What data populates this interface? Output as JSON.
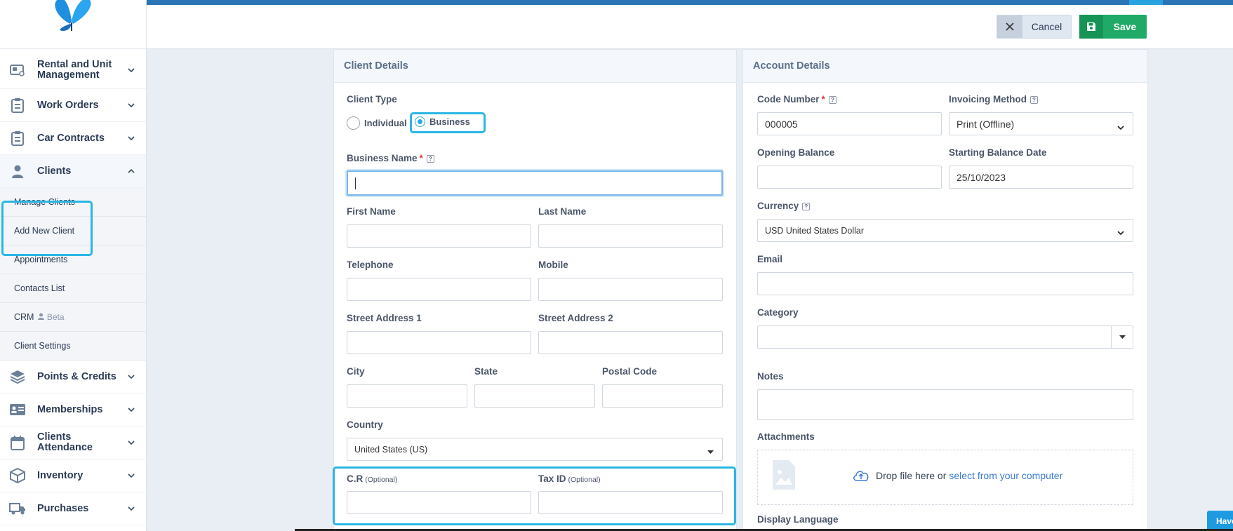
{
  "sidebar": {
    "items": [
      {
        "label": "Rental and Unit Management",
        "icon": "rental-units-icon"
      },
      {
        "label": "Work Orders",
        "icon": "clipboard-icon"
      },
      {
        "label": "Car Contracts",
        "icon": "clipboard-icon"
      },
      {
        "label": "Clients",
        "icon": "client-user-icon"
      },
      {
        "label": "Points & Credits",
        "icon": "layers-icon"
      },
      {
        "label": "Memberships",
        "icon": "id-card-icon"
      },
      {
        "label": "Clients Attendance",
        "icon": "calendar-icon"
      },
      {
        "label": "Inventory",
        "icon": "box-icon"
      },
      {
        "label": "Purchases",
        "icon": "truck-icon"
      }
    ],
    "clients_sub": [
      "Manage Clients",
      "Add New Client",
      "Appointments",
      "Contacts List",
      "CRM",
      "Client Settings"
    ],
    "crm_badge": "Beta"
  },
  "header": {
    "cancel_label": "Cancel",
    "save_label": "Save"
  },
  "client_details": {
    "title": "Client Details",
    "client_type_label": "Client Type",
    "type_individual": "Individual",
    "type_business": "Business",
    "selected_type": "Business",
    "business_name_label": "Business Name",
    "business_name_value": "",
    "first_name_label": "First Name",
    "last_name_label": "Last Name",
    "telephone_label": "Telephone",
    "mobile_label": "Mobile",
    "street1_label": "Street Address 1",
    "street2_label": "Street Address 2",
    "city_label": "City",
    "state_label": "State",
    "postal_label": "Postal Code",
    "country_label": "Country",
    "country_value": "United States (US)",
    "cr_label": "C.R",
    "taxid_label": "Tax ID",
    "optional": "(Optional)"
  },
  "account_details": {
    "title": "Account Details",
    "code_number_label": "Code Number",
    "code_number_value": "000005",
    "invoicing_label": "Invoicing Method",
    "invoicing_value": "Print (Offline)",
    "opening_balance_label": "Opening Balance",
    "opening_balance_value": "",
    "starting_date_label": "Starting Balance Date",
    "starting_date_value": "25/10/2023",
    "currency_label": "Currency",
    "currency_value": "USD United States Dollar",
    "email_label": "Email",
    "category_label": "Category",
    "notes_label": "Notes",
    "attachments_label": "Attachments",
    "drop_text": "Drop file here or",
    "drop_link": "select from your computer",
    "display_language_label": "Display Language"
  },
  "help_tab": "Have",
  "colors": {
    "accent": "#2ab6e4",
    "save_green": "#1fab67",
    "top_bar": "#2b74b5",
    "required": "#e5343c",
    "link": "#3b7ad6"
  }
}
